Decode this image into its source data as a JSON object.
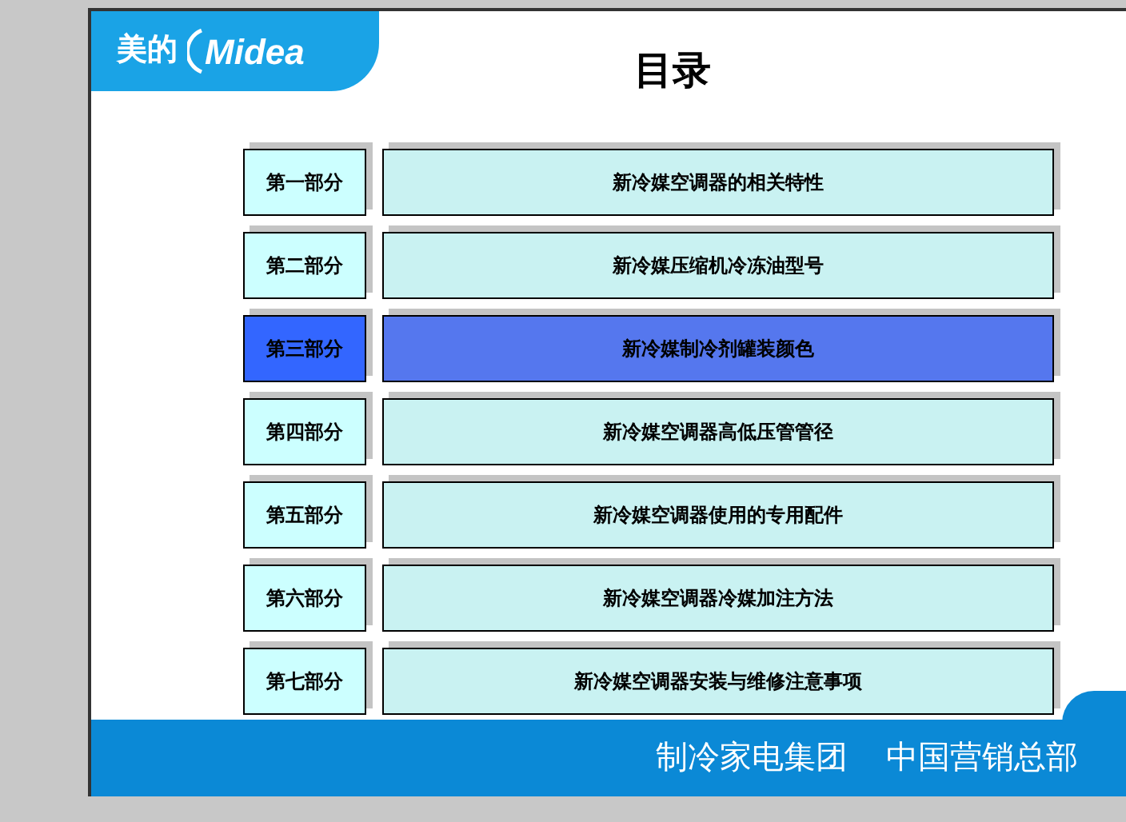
{
  "logo": {
    "chinese": "美的",
    "latin": "Midea"
  },
  "title": "目录",
  "sections": [
    {
      "part": "第一部分",
      "topic": "新冷媒空调器的相关特性",
      "selected": false
    },
    {
      "part": "第二部分",
      "topic": "新冷媒压缩机冷冻油型号",
      "selected": false
    },
    {
      "part": "第三部分",
      "topic": "新冷媒制冷剂罐装颜色",
      "selected": true
    },
    {
      "part": "第四部分",
      "topic": "新冷媒空调器高低压管管径",
      "selected": false
    },
    {
      "part": "第五部分",
      "topic": "新冷媒空调器使用的专用配件",
      "selected": false
    },
    {
      "part": "第六部分",
      "topic": "新冷媒空调器冷媒加注方法",
      "selected": false
    },
    {
      "part": "第七部分",
      "topic": "新冷媒空调器安装与维修注意事项",
      "selected": false
    }
  ],
  "footer": [
    "制冷家电集团",
    "中国营销总部"
  ]
}
